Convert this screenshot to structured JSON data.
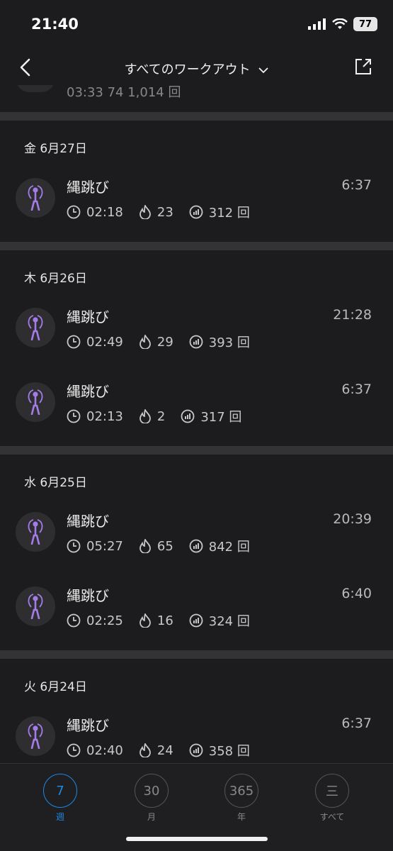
{
  "status_bar": {
    "time": "21:40",
    "battery": "77"
  },
  "nav": {
    "title": "すべてのワークアウト"
  },
  "cut_row": {
    "stats": "03:33 74 1,014 回"
  },
  "sections": [
    {
      "date": "金 6月27日",
      "items": [
        {
          "title": "縄跳び",
          "time": "6:37",
          "duration": "02:18",
          "calories": "23",
          "count": "312 回"
        }
      ]
    },
    {
      "date": "木 6月26日",
      "items": [
        {
          "title": "縄跳び",
          "time": "21:28",
          "duration": "02:49",
          "calories": "29",
          "count": "393 回"
        },
        {
          "title": "縄跳び",
          "time": "6:37",
          "duration": "02:13",
          "calories": "2",
          "count": "317 回"
        }
      ]
    },
    {
      "date": "水 6月25日",
      "items": [
        {
          "title": "縄跳び",
          "time": "20:39",
          "duration": "05:27",
          "calories": "65",
          "count": "842 回"
        },
        {
          "title": "縄跳び",
          "time": "6:40",
          "duration": "02:25",
          "calories": "16",
          "count": "324 回"
        }
      ]
    },
    {
      "date": "火 6月24日",
      "items": [
        {
          "title": "縄跳び",
          "time": "6:37",
          "duration": "02:40",
          "calories": "24",
          "count": "358 回"
        }
      ]
    }
  ],
  "tabs": [
    {
      "value": "7",
      "label": "週",
      "active": true
    },
    {
      "value": "30",
      "label": "月",
      "active": false
    },
    {
      "value": "365",
      "label": "年",
      "active": false
    },
    {
      "value": "三",
      "label": "すべて",
      "active": false
    }
  ],
  "colors": {
    "accent": "#1e88e5",
    "icon": "#a47ce8"
  }
}
